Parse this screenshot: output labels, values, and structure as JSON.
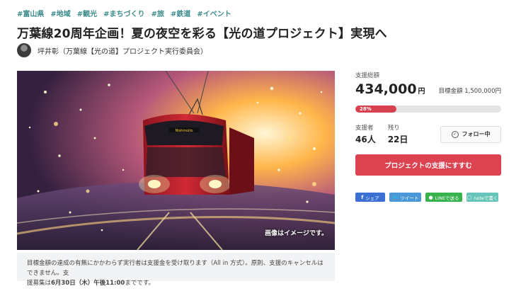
{
  "tags": [
    "#富山県",
    "#地域",
    "#観光",
    "#まちづくり",
    "#旅",
    "#鉄道",
    "#イベント"
  ],
  "title": "万葉線20周年企画！夏の夜空を彩る【光の道プロジェクト】実現へ",
  "owner": {
    "name": "坪井彰（万葉線【光の道】プロジェクト実行委員会）"
  },
  "hero": {
    "tram_sign": "Nishinoito",
    "caption": "画像はイメージです。"
  },
  "notice": {
    "line1": "目標金額の達成の有無にかかわらず実行者は支援金を受け取ります（All in 方式）。原則、支援のキャンセルはできません。支",
    "line2_prefix": "援募集は",
    "deadline": "6月30日（木）午後11:00",
    "line2_suffix": "までです。"
  },
  "funding": {
    "total_label": "支援総額",
    "amount": "434,000",
    "currency": "円",
    "goal_text": "目標金額 1,500,000円",
    "progress_label": "28%",
    "progress_fraction": 0.28,
    "progress_color": "#d6404f"
  },
  "stats": {
    "supporters_label": "支援者",
    "supporters_value": "46人",
    "remaining_label": "残り",
    "remaining_value": "22日"
  },
  "follow": {
    "label": "フォロー中",
    "icon": "check-circle-icon"
  },
  "support_button": "プロジェクトの支援にすすむ",
  "share": {
    "facebook": "シェア",
    "twitter": "ツイート",
    "line": "LINEで送る",
    "note": "noteで書く"
  },
  "colors": {
    "accent": "#dc4250",
    "tag": "#3b8b8b"
  }
}
